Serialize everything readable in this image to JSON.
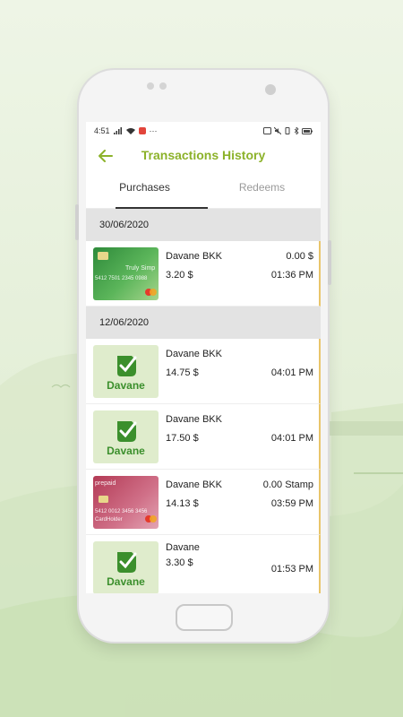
{
  "status_bar": {
    "time": "4:51",
    "more": "···"
  },
  "header": {
    "title": "Transactions History"
  },
  "tabs": [
    {
      "label": "Purchases",
      "active": true
    },
    {
      "label": "Redeems",
      "active": false
    }
  ],
  "groups": [
    {
      "date": "30/06/2020",
      "transactions": [
        {
          "merchant": "Davane BKK",
          "amount": "3.20 $",
          "extra": "0.00 $",
          "time": "01:36 PM",
          "thumbnail": "green-card",
          "card_text": {
            "brand": "Truly Simp",
            "number": "5412 7501 2345 0988"
          }
        }
      ]
    },
    {
      "date": "12/06/2020",
      "transactions": [
        {
          "merchant": "Davane BKK",
          "amount": "14.75 $",
          "extra": "",
          "time": "04:01 PM",
          "thumbnail": "davane-logo"
        },
        {
          "merchant": "Davane BKK",
          "amount": "17.50 $",
          "extra": "",
          "time": "04:01 PM",
          "thumbnail": "davane-logo"
        },
        {
          "merchant": "Davane BKK",
          "amount": "14.13 $",
          "extra": "0.00 Stamp",
          "time": "03:59 PM",
          "thumbnail": "red-card",
          "card_text": {
            "brand": "prepaid",
            "number": "5412 0012 3456 3456",
            "holder": "CardHolder"
          }
        },
        {
          "merchant": "Davane",
          "amount": "3.30 $",
          "extra": "",
          "time": "01:53 PM",
          "thumbnail": "davane-logo"
        }
      ]
    }
  ],
  "logo_text": "Davane",
  "colors": {
    "accent": "#8cb22a",
    "logo_green": "#3b8f2c",
    "divider": "#e9c56a"
  }
}
